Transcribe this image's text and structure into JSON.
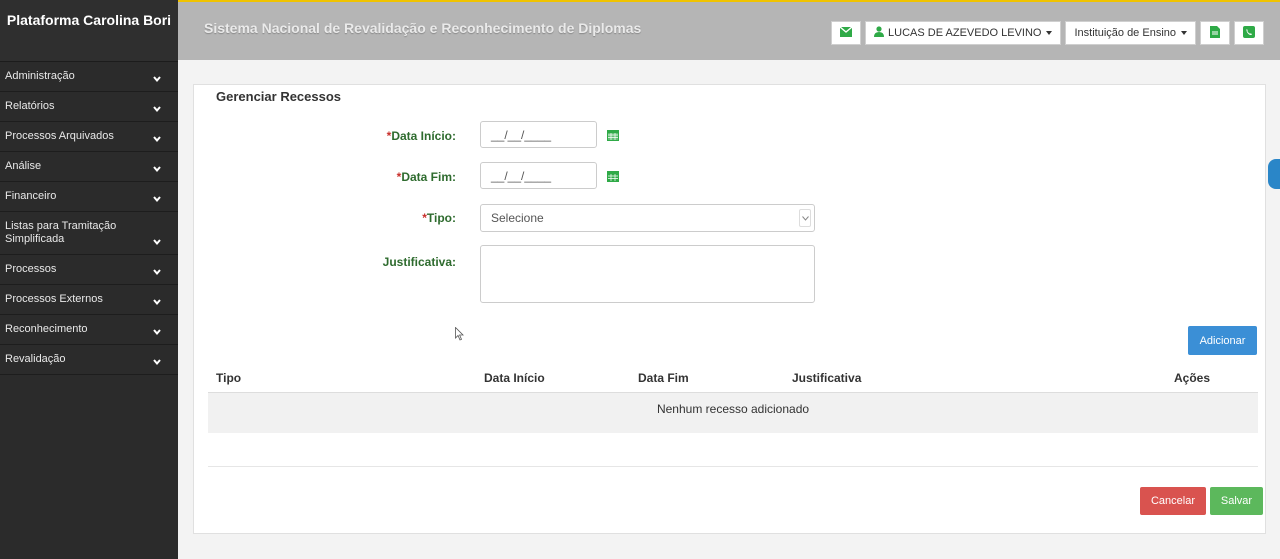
{
  "sidebar": {
    "brand": "Plataforma Carolina Bori",
    "items": [
      {
        "label": "Administração"
      },
      {
        "label": "Relatórios"
      },
      {
        "label": "Processos Arquivados"
      },
      {
        "label": "Análise"
      },
      {
        "label": "Financeiro"
      },
      {
        "label": "Listas para Tramitação Simplificada"
      },
      {
        "label": "Processos"
      },
      {
        "label": "Processos Externos"
      },
      {
        "label": "Reconhecimento"
      },
      {
        "label": "Revalidação"
      }
    ]
  },
  "header": {
    "title": "Sistema Nacional de Revalidação e Reconhecimento de Diplomas",
    "user_name": "LUCAS DE AZEVEDO LEVINO",
    "institution": "Instituição de Ensino",
    "icons": [
      "envelope-icon",
      "user-icon",
      "document-icon",
      "phone-icon"
    ]
  },
  "form": {
    "title": "Gerenciar Recessos",
    "required_mark": "*",
    "data_inicio_label": "Data Início:",
    "data_inicio_value": "__/__/____",
    "data_fim_label": "Data Fim:",
    "data_fim_value": "__/__/____",
    "tipo_label": "Tipo:",
    "tipo_selected": "Selecione",
    "justificativa_label": "Justificativa:",
    "justificativa_value": "",
    "add_button": "Adicionar"
  },
  "table": {
    "columns": [
      "Tipo",
      "Data Início",
      "Data Fim",
      "Justificativa",
      "Ações"
    ],
    "empty_message": "Nenhum recesso adicionado"
  },
  "footer": {
    "cancel_button": "Cancelar",
    "save_button": "Salvar"
  },
  "colors": {
    "sidebar_bg": "#2b2b2b",
    "topbar_bg": "#b5b5b5",
    "label_green": "#2e6b2e",
    "required_red": "#c9302c",
    "primary_blue": "#3b8fd6",
    "danger_red": "#d9534f",
    "success_green": "#5cb85c",
    "icon_green": "#2faa47"
  }
}
